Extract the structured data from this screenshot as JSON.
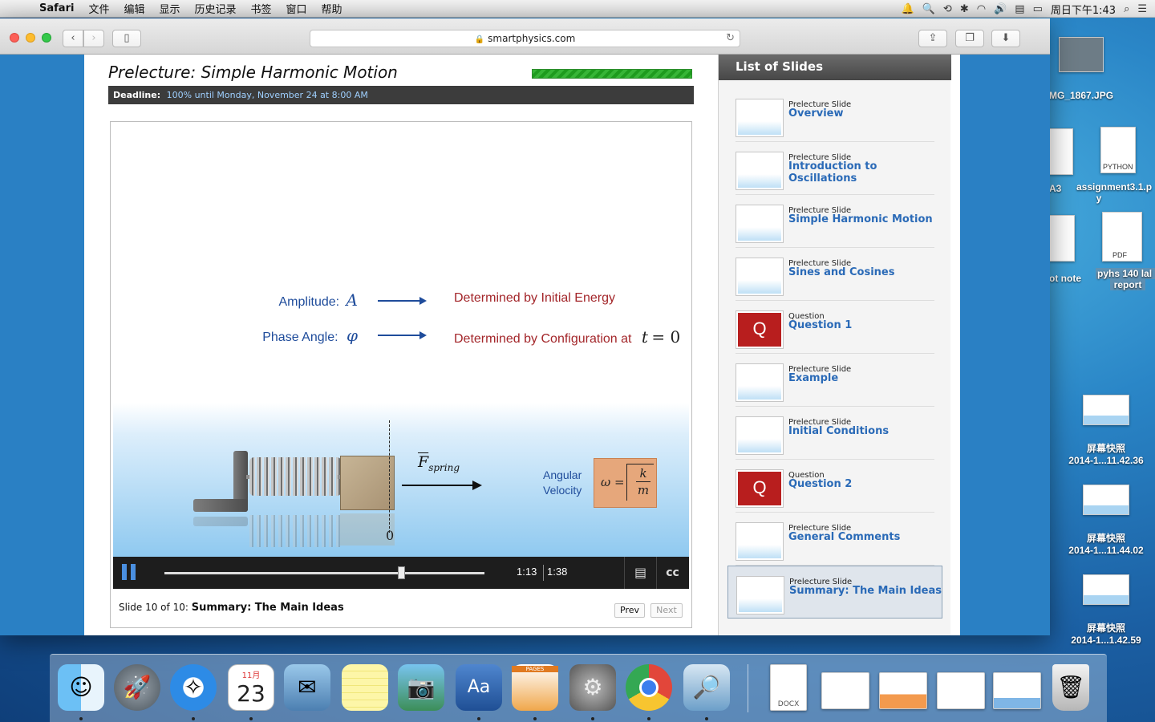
{
  "menubar": {
    "app": "Safari",
    "items": [
      "文件",
      "编辑",
      "显示",
      "历史记录",
      "书签",
      "窗口",
      "帮助"
    ],
    "clock": "周日下午1:43"
  },
  "browser": {
    "url": "smartphysics.com"
  },
  "lecture": {
    "title": "Prelecture: Simple Harmonic Motion",
    "deadline_label": "Deadline:",
    "deadline_value": "100% until Monday, November 24 at 8:00 AM",
    "slide": {
      "amplitude_label": "Amplitude:",
      "amplitude_sym": "A",
      "amplitude_text": "Determined by Initial Energy",
      "phase_label": "Phase Angle:",
      "phase_sym": "φ",
      "phase_text": "Determined by Configuration at",
      "phase_cond_t": "t",
      "phase_cond_rest": "= 0",
      "zero": "0",
      "force": "F",
      "force_sub": "spring",
      "angular": "Angular",
      "velocity": "Velocity",
      "omega": "ω =",
      "k": "k",
      "m": "m"
    },
    "player": {
      "current_time": "1:13",
      "total_time": "1:38",
      "progress": 0.74
    },
    "caption_prefix": "Slide 10 of 10:",
    "caption_title": "Summary: The Main Ideas",
    "prev": "Prev",
    "next": "Next"
  },
  "slides_panel": {
    "title": "List of Slides",
    "items": [
      {
        "type": "Prelecture Slide",
        "name": "Overview"
      },
      {
        "type": "Prelecture Slide",
        "name": "Introduction to Oscillations"
      },
      {
        "type": "Prelecture Slide",
        "name": "Simple Harmonic Motion"
      },
      {
        "type": "Prelecture Slide",
        "name": "Sines and Cosines"
      },
      {
        "type": "Question",
        "name": "Question 1"
      },
      {
        "type": "Prelecture Slide",
        "name": "Example"
      },
      {
        "type": "Prelecture Slide",
        "name": "Initial Conditions"
      },
      {
        "type": "Question",
        "name": "Question 2"
      },
      {
        "type": "Prelecture Slide",
        "name": "General Comments"
      },
      {
        "type": "Prelecture Slide",
        "name": "Summary: The Main Ideas"
      }
    ]
  },
  "desktop": {
    "items": [
      {
        "label": "MG_1867.JPG"
      },
      {
        "label": "A3"
      },
      {
        "label": "assignment3.1.py",
        "line1": "assignment3.1.p",
        "line2": "y",
        "badge": "PYTHON"
      },
      {
        "label": "ot note"
      },
      {
        "label": "pyhs 140 lab report",
        "line1": "pyhs 140 lal",
        "line2": "report",
        "badge": "PDF"
      },
      {
        "label1": "屏幕快照",
        "label2": "2014-1...11.42.36"
      },
      {
        "label1": "屏幕快照",
        "label2": "2014-1...11.44.02"
      },
      {
        "label1": "屏幕快照",
        "label2": "2014-1...1.42.59"
      }
    ]
  },
  "dock": {
    "calendar_month": "11月",
    "calendar_day": "23",
    "docx": "DOCX",
    "pages": "PAGES"
  }
}
